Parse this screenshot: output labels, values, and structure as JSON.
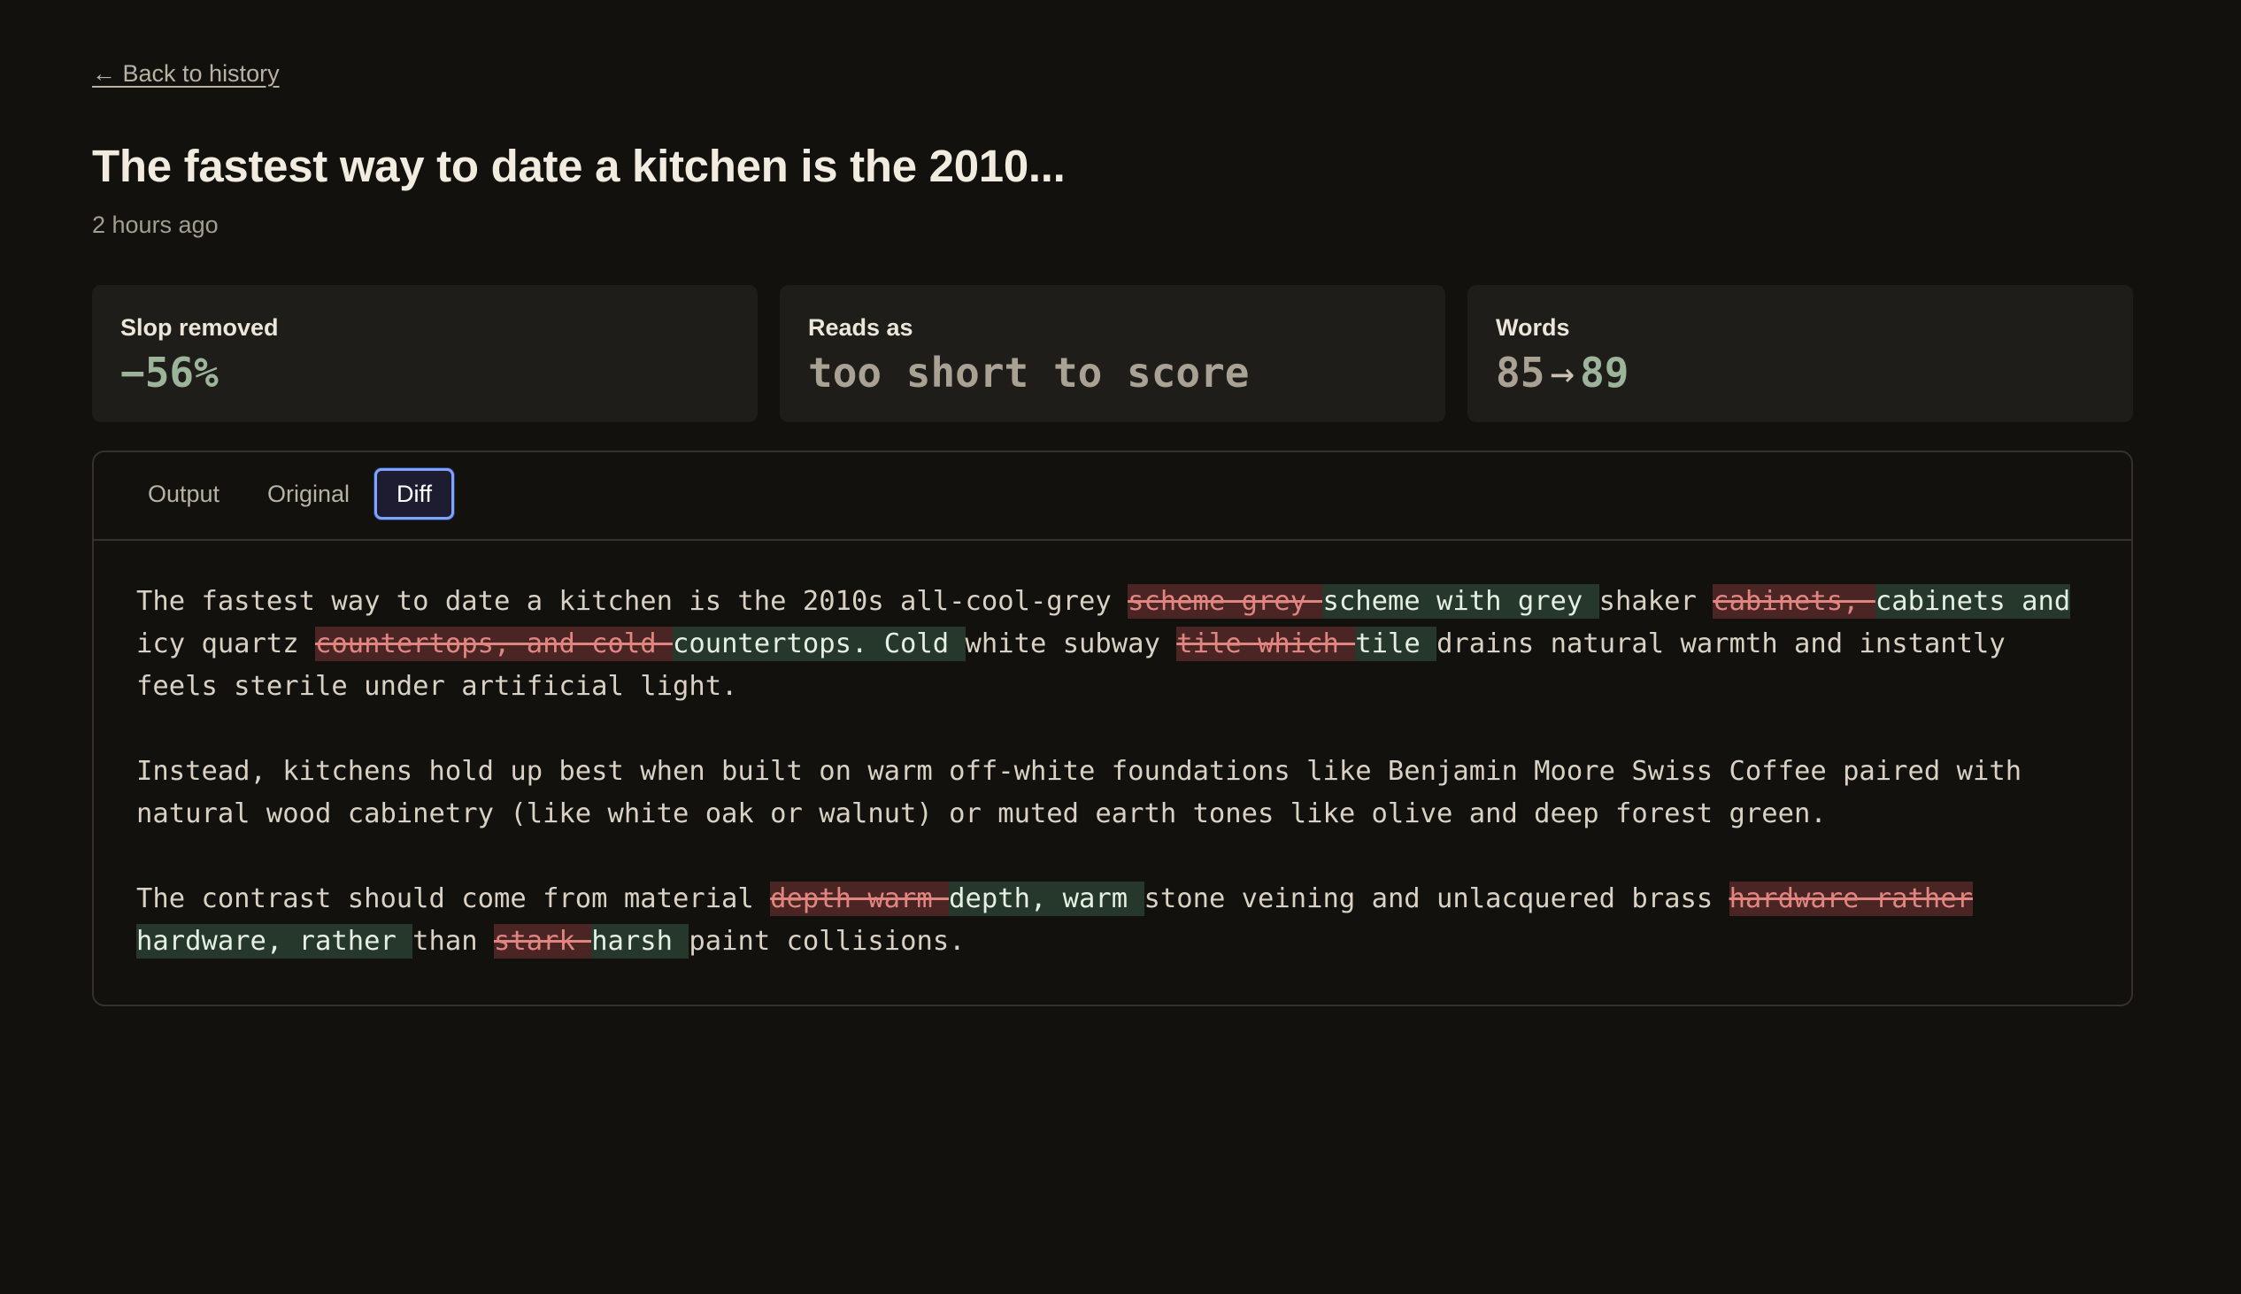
{
  "nav": {
    "back_label": "← Back to history"
  },
  "header": {
    "title": "The fastest way to date a kitchen is the 2010...",
    "timestamp": "2 hours ago"
  },
  "stats": [
    {
      "label": "Slop removed",
      "value": "−56%"
    },
    {
      "label": "Reads as",
      "value": "too short to score"
    },
    {
      "label": "Words",
      "value_from": "85",
      "arrow": "→",
      "value_to": "89"
    }
  ],
  "tabs": [
    {
      "label": "Output",
      "active": false
    },
    {
      "label": "Original",
      "active": false
    },
    {
      "label": "Diff",
      "active": true
    }
  ],
  "diff": {
    "paragraphs": [
      [
        {
          "t": "eq",
          "s": "The fastest way to date a kitchen is the 2010s all-cool-grey "
        },
        {
          "t": "del",
          "s": "scheme grey "
        },
        {
          "t": "ins",
          "s": "scheme with grey "
        },
        {
          "t": "eq",
          "s": "shaker "
        },
        {
          "t": "del",
          "s": "cabinets, "
        },
        {
          "t": "ins",
          "s": "cabinets and "
        },
        {
          "t": "eq",
          "s": "icy quartz "
        },
        {
          "t": "del",
          "s": "countertops, and cold "
        },
        {
          "t": "ins",
          "s": "countertops. Cold "
        },
        {
          "t": "eq",
          "s": "white subway "
        },
        {
          "t": "del",
          "s": "tile which "
        },
        {
          "t": "ins",
          "s": "tile "
        },
        {
          "t": "eq",
          "s": "drains natural warmth and instantly feels sterile under artificial light."
        }
      ],
      [
        {
          "t": "eq",
          "s": "Instead, kitchens hold up best when built on warm off-white foundations like Benjamin Moore Swiss Coffee paired with natural wood cabinetry (like white oak or walnut) or muted earth tones like olive and deep forest green."
        }
      ],
      [
        {
          "t": "eq",
          "s": "The contrast should come from material "
        },
        {
          "t": "del",
          "s": "depth warm "
        },
        {
          "t": "ins",
          "s": "depth, warm "
        },
        {
          "t": "eq",
          "s": "stone veining and unlacquered brass "
        },
        {
          "t": "del",
          "s": "hardware rather "
        },
        {
          "t": "ins",
          "s": "hardware, rather "
        },
        {
          "t": "eq",
          "s": "than "
        },
        {
          "t": "del",
          "s": "stark "
        },
        {
          "t": "ins",
          "s": "harsh "
        },
        {
          "t": "eq",
          "s": "paint collisions."
        }
      ]
    ]
  },
  "colors": {
    "background": "#12110e",
    "card": "#1f1d19",
    "deleted_bg": "#4a2524",
    "deleted_text": "#e08580",
    "inserted_bg": "#26382b",
    "accent_focus": "#7ea4ff"
  }
}
